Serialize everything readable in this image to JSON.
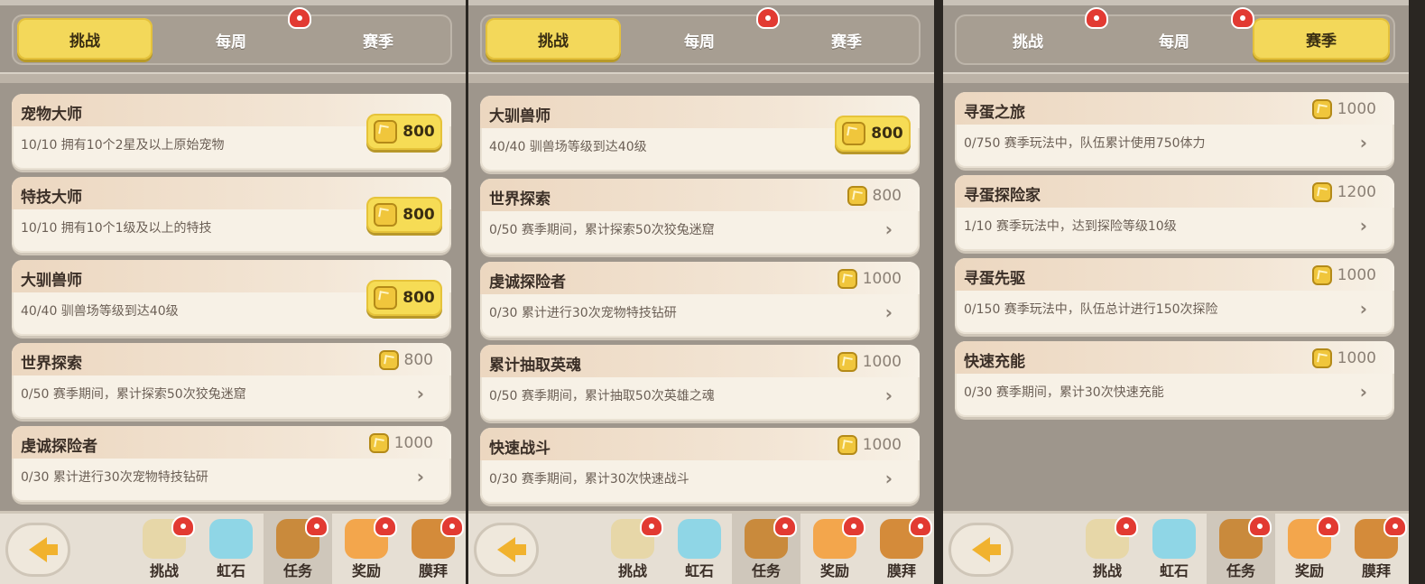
{
  "tabs": [
    "挑战",
    "每周",
    "赛季"
  ],
  "bottom_nav": [
    "挑战",
    "虹石",
    "任务",
    "奖励",
    "膜拜"
  ],
  "panels": [
    {
      "active_tab": 0,
      "cards": [
        {
          "title": "宠物大师",
          "desc": "10/10 拥有10个2星及以上原始宠物",
          "reward": "800",
          "claimable": true
        },
        {
          "title": "特技大师",
          "desc": "10/10 拥有10个1级及以上的特技",
          "reward": "800",
          "claimable": true
        },
        {
          "title": "大驯兽师",
          "desc": "40/40 驯兽场等级到达40级",
          "reward": "800",
          "claimable": true
        },
        {
          "title": "世界探索",
          "desc": "0/50 赛季期间，累计探索50次狡兔迷窟",
          "reward": "800",
          "claimable": false
        },
        {
          "title": "虔诚探险者",
          "desc": "0/30 累计进行30次宠物特技钻研",
          "reward": "1000",
          "claimable": false
        }
      ]
    },
    {
      "active_tab": 0,
      "cards": [
        {
          "title": "大驯兽师",
          "desc": "40/40 驯兽场等级到达40级",
          "reward": "800",
          "claimable": true
        },
        {
          "title": "世界探索",
          "desc": "0/50 赛季期间，累计探索50次狡兔迷窟",
          "reward": "800",
          "claimable": false
        },
        {
          "title": "虔诚探险者",
          "desc": "0/30 累计进行30次宠物特技钻研",
          "reward": "1000",
          "claimable": false
        },
        {
          "title": "累计抽取英魂",
          "desc": "0/50 赛季期间，累计抽取50次英雄之魂",
          "reward": "1000",
          "claimable": false
        },
        {
          "title": "快速战斗",
          "desc": "0/30 赛季期间，累计30次快速战斗",
          "reward": "1000",
          "claimable": false
        }
      ]
    },
    {
      "active_tab": 2,
      "cards": [
        {
          "title": "寻蛋之旅",
          "desc": "0/750 赛季玩法中，队伍累计使用750体力",
          "reward": "1000",
          "claimable": false
        },
        {
          "title": "寻蛋探险家",
          "desc": "1/10 赛季玩法中，达到探险等级10级",
          "reward": "1200",
          "claimable": false
        },
        {
          "title": "寻蛋先驱",
          "desc": "0/150 赛季玩法中，队伍总计进行150次探险",
          "reward": "1000",
          "claimable": false
        },
        {
          "title": "快速充能",
          "desc": "0/30 赛季期间，累计30次快速充能",
          "reward": "1000",
          "claimable": false
        }
      ]
    }
  ],
  "nav_colors": [
    "#e7d7a8",
    "#8fd6e6",
    "#c98a3c",
    "#f3a64c",
    "#d48b3a"
  ]
}
